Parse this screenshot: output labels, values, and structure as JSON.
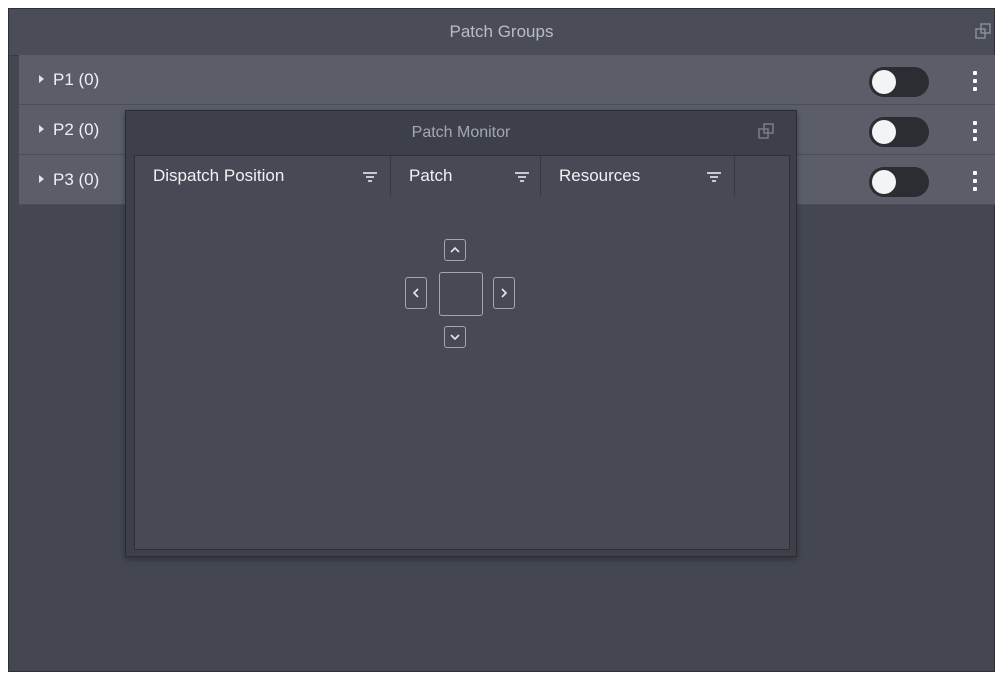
{
  "patch_groups": {
    "title": "Patch Groups",
    "undock_icon": "undock-icon",
    "groups": [
      {
        "label": "P1 (0)",
        "enabled": false
      },
      {
        "label": "P2 (0)",
        "enabled": false
      },
      {
        "label": "P3 (0)",
        "enabled": false
      }
    ]
  },
  "patch_monitor": {
    "title": "Patch Monitor",
    "undock_icon": "undock-icon",
    "columns": [
      {
        "label": "Dispatch Position",
        "icon": "filter-icon"
      },
      {
        "label": "Patch",
        "icon": "filter-icon"
      },
      {
        "label": "Resources",
        "icon": "filter-icon"
      }
    ],
    "nav_pad": {
      "up": "chevron-up-icon",
      "left": "chevron-left-icon",
      "right": "chevron-right-icon",
      "down": "chevron-down-icon"
    }
  },
  "colors": {
    "panel_bg": "#444750",
    "row_bg": "#5b5e68",
    "monitor_bg": "#3d4049",
    "toggle_off": "#2b2d33"
  }
}
